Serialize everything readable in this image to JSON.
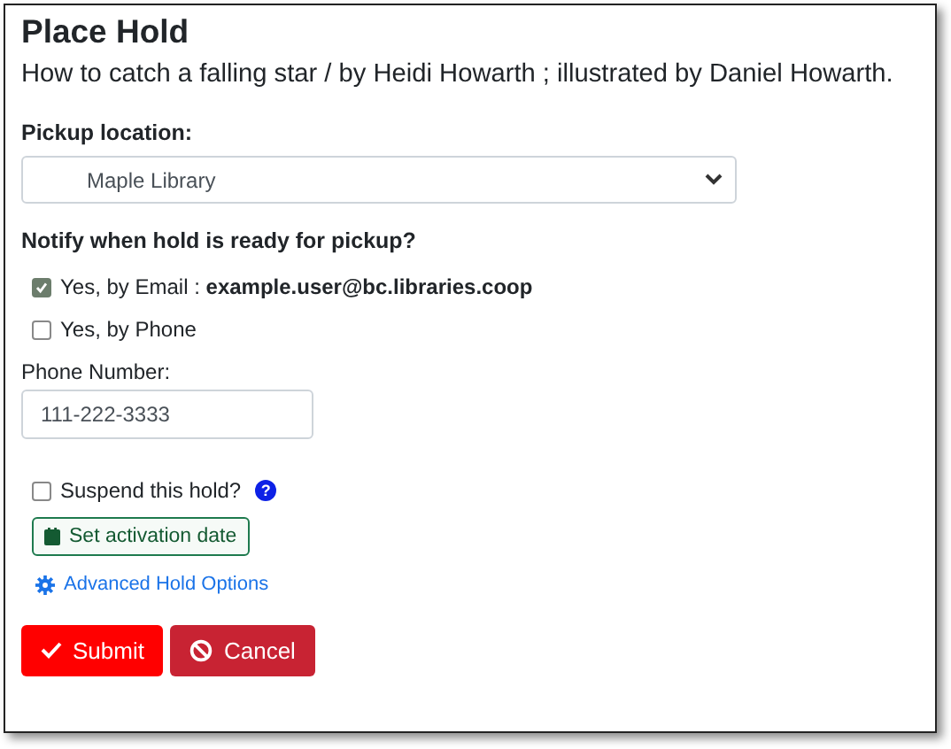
{
  "title": "Place Hold",
  "item_title": "How to catch a falling star / by Heidi Howarth ; illustrated by Daniel Howarth.",
  "pickup": {
    "label": "Pickup location:",
    "value": "Maple Library"
  },
  "notify": {
    "heading": "Notify when hold is ready for pickup?",
    "options": [
      {
        "label": "Yes, by Email : **example.user@bc.libraries.coop**",
        "checked": true
      },
      {
        "label": "Yes, by Phone",
        "checked": false
      }
    ]
  },
  "phone": {
    "label": "Phone Number:",
    "value": "111-222-3333"
  },
  "suspend": {
    "label": "Suspend this hold?",
    "checked": false,
    "help": "?"
  },
  "activation_button": "Set activation date",
  "advanced_link": "Advanced Hold Options",
  "buttons": [
    {
      "kind": "submit",
      "label": "Submit"
    },
    {
      "kind": "cancel",
      "label": "Cancel"
    }
  ]
}
